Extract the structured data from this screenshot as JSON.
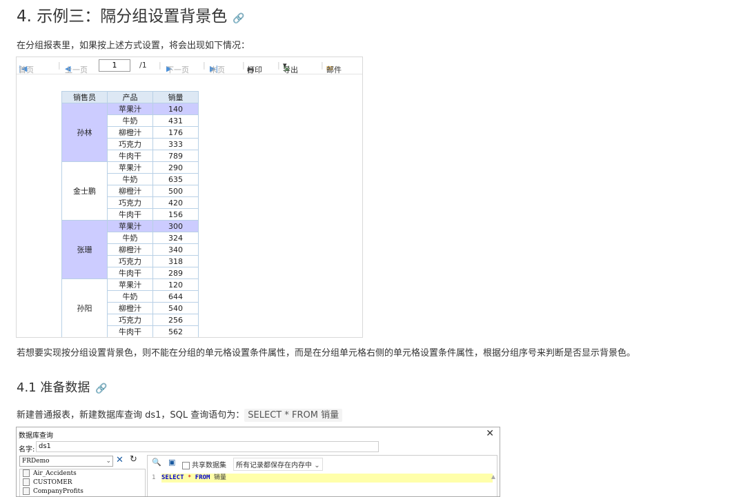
{
  "heading": {
    "title": "4. 示例三：隔分组设置背景色",
    "anchor_icon": "link-icon"
  },
  "intro": "在分组报表里，如果按上述方式设置，将会出现如下情况：",
  "toolbar": {
    "first": "首页",
    "prev": "上一页",
    "page_value": "1",
    "page_total": "/1",
    "next": "下一页",
    "last": "末页",
    "print": "打印",
    "export": "导出",
    "mail": "邮件"
  },
  "report": {
    "headers": [
      "销售员",
      "产品",
      "销量"
    ],
    "highlight_color": "#ccccff",
    "groups": [
      {
        "name": "孙林",
        "highlight": true,
        "rows": [
          [
            "苹果汁",
            "140"
          ],
          [
            "牛奶",
            "431"
          ],
          [
            "柳橙汁",
            "176"
          ],
          [
            "巧克力",
            "333"
          ],
          [
            "牛肉干",
            "789"
          ]
        ]
      },
      {
        "name": "金士鹏",
        "highlight": false,
        "rows": [
          [
            "苹果汁",
            "290"
          ],
          [
            "牛奶",
            "635"
          ],
          [
            "柳橙汁",
            "500"
          ],
          [
            "巧克力",
            "420"
          ],
          [
            "牛肉干",
            "156"
          ]
        ]
      },
      {
        "name": "张珊",
        "highlight": true,
        "rows": [
          [
            "苹果汁",
            "300"
          ],
          [
            "牛奶",
            "324"
          ],
          [
            "柳橙汁",
            "340"
          ],
          [
            "巧克力",
            "318"
          ],
          [
            "牛肉干",
            "289"
          ]
        ]
      },
      {
        "name": "孙阳",
        "highlight": false,
        "rows": [
          [
            "苹果汁",
            "120"
          ],
          [
            "牛奶",
            "644"
          ],
          [
            "柳橙汁",
            "540"
          ],
          [
            "巧克力",
            "256"
          ],
          [
            "牛肉干",
            "562"
          ]
        ]
      }
    ]
  },
  "para2": "若想要实现按分组设置背景色，则不能在分组的单元格设置条件属性，而是在分组单元格右侧的单元格设置条件属性，根据分组序号来判断是否显示背景色。",
  "sub": {
    "title": "4.1 准备数据"
  },
  "para3": {
    "text": "新建普通报表，新建数据库查询 ds1，SQL 查询语句为：",
    "code": "SELECT * FROM 销量"
  },
  "dialog": {
    "title": "数据库查询",
    "name_label": "名字:",
    "name_value": "ds1",
    "datasource": "FRDemo",
    "share_label": "共享数据集",
    "cache_option": "所有记录都保存在内存中",
    "tree": [
      "Air_Accidents",
      "CUSTOMER",
      "CompanyProfits"
    ],
    "sql_line_no": "1",
    "sql": {
      "select": "SELECT",
      "star": "*",
      "from": "FROM",
      "table": "销量"
    }
  }
}
